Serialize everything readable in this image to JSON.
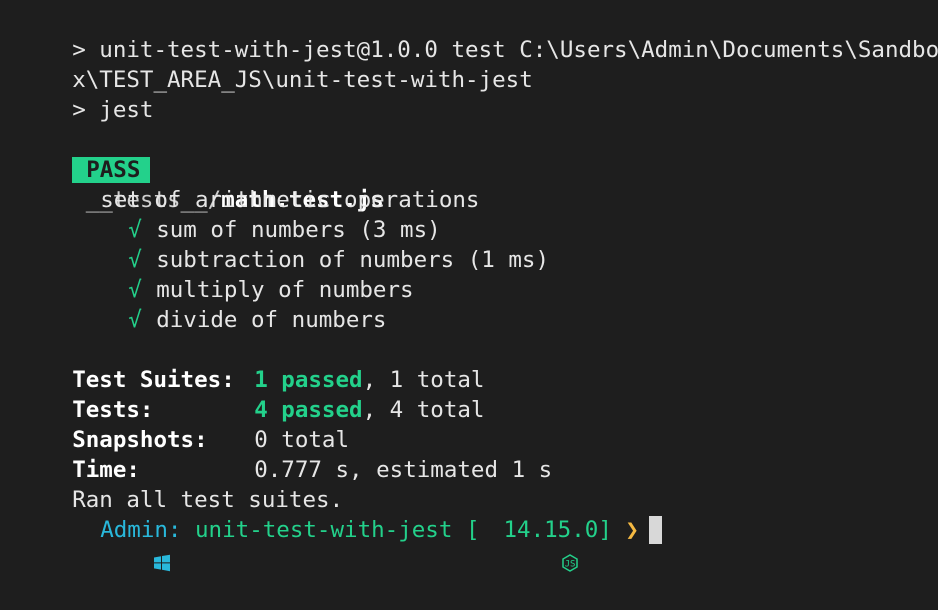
{
  "terminal": {
    "header": {
      "script_line_1": "> unit-test-with-jest@1.0.0 test C:\\Users\\Admin\\Documents\\Sandbo",
      "script_line_2": "x\\TEST_AREA_JS\\unit-test-with-jest",
      "jest_line": "> jest"
    },
    "result": {
      "status": "PASS",
      "path_prefix": "__tests__/",
      "file_name": "math.test.js",
      "suite_name": "set of arithmetic operations",
      "tests": [
        {
          "check": "√",
          "name": "sum of numbers (3 ms)"
        },
        {
          "check": "√",
          "name": "subtraction of numbers (1 ms)"
        },
        {
          "check": "√",
          "name": "multiply of numbers"
        },
        {
          "check": "√",
          "name": "divide of numbers"
        }
      ]
    },
    "summary": {
      "suites_label": "Test Suites:",
      "suites_passed": "1 passed",
      "suites_rest": ", 1 total",
      "tests_label": "Tests:",
      "tests_passed": "4 passed",
      "tests_rest": ", 4 total",
      "snapshots_label": "Snapshots:",
      "snapshots_value": "0 total",
      "time_label": "Time:",
      "time_value": "0.777 s, estimated 1 s",
      "ran_all": "Ran all test suites."
    },
    "prompt": {
      "user": "Admin:",
      "directory": "unit-test-with-jest",
      "bracket_open": "[",
      "node_version": "14.15.0",
      "bracket_close": "]",
      "arrow": "❯",
      "colors": {
        "background": "#1e1e1e",
        "pass_badge": "#23d18b",
        "user": "#29b8db",
        "directory": "#23d18b",
        "arrow": "#f5b942"
      }
    }
  }
}
